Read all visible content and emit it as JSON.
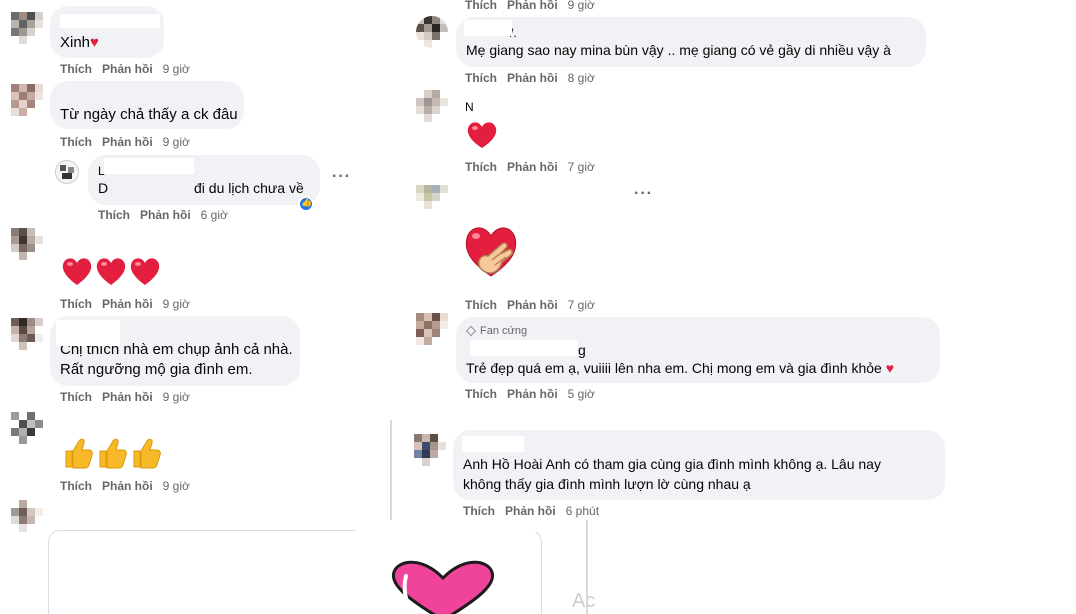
{
  "labels": {
    "like": "Thích",
    "reply": "Phản hồi"
  },
  "left": [
    {
      "text": "Xinh",
      "time": "9 giờ"
    },
    {
      "text": "Từ ngày chả thấy a ck đâu",
      "time": "9 giờ"
    },
    {
      "name_fragment": "L",
      "text_start": "D",
      "text_end": "đi du lịch chưa về",
      "time": "6 giờ"
    },
    {
      "time": "9 giờ"
    },
    {
      "line1": "Chị thích nhà em chụp ảnh cả nhà.",
      "line2": "Rất ngưỡng mộ gia đình em.",
      "time": "9 giờ"
    },
    {
      "time": "9 giờ"
    }
  ],
  "right": [
    {
      "top_time": "9 giờ"
    },
    {
      "name_fragment": "/.",
      "text": "Mẹ giang sao nay mina bùn vậy .. mẹ giang có vẻ gầy di nhiều vậy à",
      "time": "8 giờ"
    },
    {
      "name_fragment": "N",
      "time": "7 giờ"
    },
    {
      "time": "7 giờ"
    },
    {
      "badge": "Fan cứng",
      "name_fragment": "g",
      "text": "Trẻ đẹp quá em ạ, vuiiii lên nha em. Chị mong em và gia đình khỏe",
      "time": "5 giờ"
    },
    {
      "line1": "Anh Hồ Hoài Anh có tham gia cùng gia đình mình không ạ. Lâu nay",
      "line2": "không thấy gia đình mình lượn lờ cùng nhau ạ",
      "time": "6 phút"
    }
  ],
  "overlay": {
    "partial": "Ac"
  },
  "icons": [
    "avatar-pixelated",
    "heart-emoji",
    "thumbs-up-emoji",
    "heart-hands-emoji",
    "like-reaction-icon",
    "more-options-icon",
    "fan-badge-icon"
  ],
  "colors": {
    "bubble": "#f0f2f5",
    "meta": "#65676b",
    "text": "#050505",
    "heart": "#e41e3f",
    "like": "#1877f2",
    "thumb": "#f7b928"
  }
}
